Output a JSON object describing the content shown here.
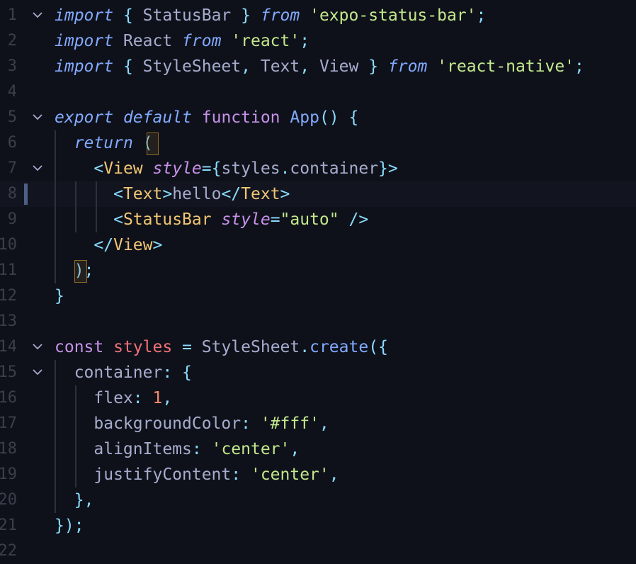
{
  "lines": [
    {
      "n": "1",
      "tokens": [
        [
          "kw",
          "import"
        ],
        [
          "id",
          " "
        ],
        [
          "pun",
          "{"
        ],
        [
          "id",
          " StatusBar "
        ],
        [
          "pun",
          "}"
        ],
        [
          "id",
          " "
        ],
        [
          "kw",
          "from"
        ],
        [
          "id",
          " "
        ],
        [
          "str",
          "'expo-status-bar'"
        ],
        [
          "pun",
          ";"
        ]
      ]
    },
    {
      "n": "2",
      "tokens": [
        [
          "kw",
          "import"
        ],
        [
          "id",
          " React "
        ],
        [
          "kw",
          "from"
        ],
        [
          "id",
          " "
        ],
        [
          "str",
          "'react'"
        ],
        [
          "pun",
          ";"
        ]
      ]
    },
    {
      "n": "3",
      "tokens": [
        [
          "kw",
          "import"
        ],
        [
          "id",
          " "
        ],
        [
          "pun",
          "{"
        ],
        [
          "id",
          " StyleSheet"
        ],
        [
          "pun",
          ","
        ],
        [
          "id",
          " Text"
        ],
        [
          "pun",
          ","
        ],
        [
          "id",
          " View "
        ],
        [
          "pun",
          "}"
        ],
        [
          "id",
          " "
        ],
        [
          "kw",
          "from"
        ],
        [
          "id",
          " "
        ],
        [
          "str",
          "'react-native'"
        ],
        [
          "pun",
          ";"
        ]
      ]
    },
    {
      "n": "4",
      "tokens": []
    },
    {
      "n": "5",
      "tokens": [
        [
          "kw",
          "export"
        ],
        [
          "id",
          " "
        ],
        [
          "kw",
          "default"
        ],
        [
          "id",
          " "
        ],
        [
          "kw2",
          "function"
        ],
        [
          "id",
          " "
        ],
        [
          "fn",
          "App"
        ],
        [
          "pun",
          "()"
        ],
        [
          "id",
          " "
        ],
        [
          "pun",
          "{"
        ]
      ]
    },
    {
      "n": "6",
      "tokens": [
        [
          "id",
          "  "
        ],
        [
          "kw",
          "return"
        ],
        [
          "id",
          " "
        ],
        [
          "pun",
          "("
        ]
      ]
    },
    {
      "n": "7",
      "tokens": [
        [
          "id",
          "    "
        ],
        [
          "pun",
          "<"
        ],
        [
          "tag",
          "View"
        ],
        [
          "id",
          " "
        ],
        [
          "attr",
          "style"
        ],
        [
          "pun",
          "="
        ],
        [
          "pun",
          "{"
        ],
        [
          "id",
          "styles"
        ],
        [
          "pun",
          "."
        ],
        [
          "id",
          "container"
        ],
        [
          "pun",
          "}"
        ],
        [
          "pun",
          ">"
        ]
      ]
    },
    {
      "n": "8",
      "tokens": [
        [
          "id",
          "      "
        ],
        [
          "pun",
          "<"
        ],
        [
          "tag",
          "Text"
        ],
        [
          "pun",
          ">"
        ],
        [
          "id",
          "hello"
        ],
        [
          "pun",
          "</"
        ],
        [
          "tag",
          "Text"
        ],
        [
          "pun",
          ">"
        ]
      ]
    },
    {
      "n": "9",
      "tokens": [
        [
          "id",
          "      "
        ],
        [
          "pun",
          "<"
        ],
        [
          "tag",
          "StatusBar"
        ],
        [
          "id",
          " "
        ],
        [
          "attr",
          "style"
        ],
        [
          "pun",
          "="
        ],
        [
          "str",
          "\"auto\""
        ],
        [
          "id",
          " "
        ],
        [
          "pun",
          "/>"
        ]
      ]
    },
    {
      "n": "10",
      "tokens": [
        [
          "id",
          "    "
        ],
        [
          "pun",
          "</"
        ],
        [
          "tag",
          "View"
        ],
        [
          "pun",
          ">"
        ]
      ]
    },
    {
      "n": "11",
      "tokens": [
        [
          "id",
          "  "
        ],
        [
          "pun",
          ")"
        ],
        [
          "pun",
          ";"
        ]
      ]
    },
    {
      "n": "12",
      "tokens": [
        [
          "pun",
          "}"
        ]
      ]
    },
    {
      "n": "13",
      "tokens": []
    },
    {
      "n": "14",
      "tokens": [
        [
          "kw2",
          "const"
        ],
        [
          "id",
          " "
        ],
        [
          "var",
          "styles"
        ],
        [
          "id",
          " "
        ],
        [
          "pun",
          "="
        ],
        [
          "id",
          " StyleSheet"
        ],
        [
          "pun",
          "."
        ],
        [
          "fn",
          "create"
        ],
        [
          "pun",
          "("
        ],
        [
          "pun",
          "{"
        ]
      ]
    },
    {
      "n": "15",
      "tokens": [
        [
          "id",
          "  container"
        ],
        [
          "pun",
          ":"
        ],
        [
          "id",
          " "
        ],
        [
          "pun",
          "{"
        ]
      ]
    },
    {
      "n": "16",
      "tokens": [
        [
          "id",
          "    flex"
        ],
        [
          "pun",
          ":"
        ],
        [
          "id",
          " "
        ],
        [
          "num",
          "1"
        ],
        [
          "pun",
          ","
        ]
      ]
    },
    {
      "n": "17",
      "tokens": [
        [
          "id",
          "    backgroundColor"
        ],
        [
          "pun",
          ":"
        ],
        [
          "id",
          " "
        ],
        [
          "str",
          "'#fff'"
        ],
        [
          "pun",
          ","
        ]
      ]
    },
    {
      "n": "18",
      "tokens": [
        [
          "id",
          "    alignItems"
        ],
        [
          "pun",
          ":"
        ],
        [
          "id",
          " "
        ],
        [
          "str",
          "'center'"
        ],
        [
          "pun",
          ","
        ]
      ]
    },
    {
      "n": "19",
      "tokens": [
        [
          "id",
          "    justifyContent"
        ],
        [
          "pun",
          ":"
        ],
        [
          "id",
          " "
        ],
        [
          "str",
          "'center'"
        ],
        [
          "pun",
          ","
        ]
      ]
    },
    {
      "n": "20",
      "tokens": [
        [
          "id",
          "  "
        ],
        [
          "pun",
          "}"
        ],
        [
          "pun",
          ","
        ]
      ]
    },
    {
      "n": "21",
      "tokens": [
        [
          "pun",
          "}"
        ],
        [
          "pun",
          ")"
        ],
        [
          "pun",
          ";"
        ]
      ]
    },
    {
      "n": "22",
      "tokens": []
    }
  ],
  "active_line": 8,
  "fold_lines": [
    1,
    5,
    7,
    14,
    15
  ],
  "fold_icon": "chevron-down-icon"
}
